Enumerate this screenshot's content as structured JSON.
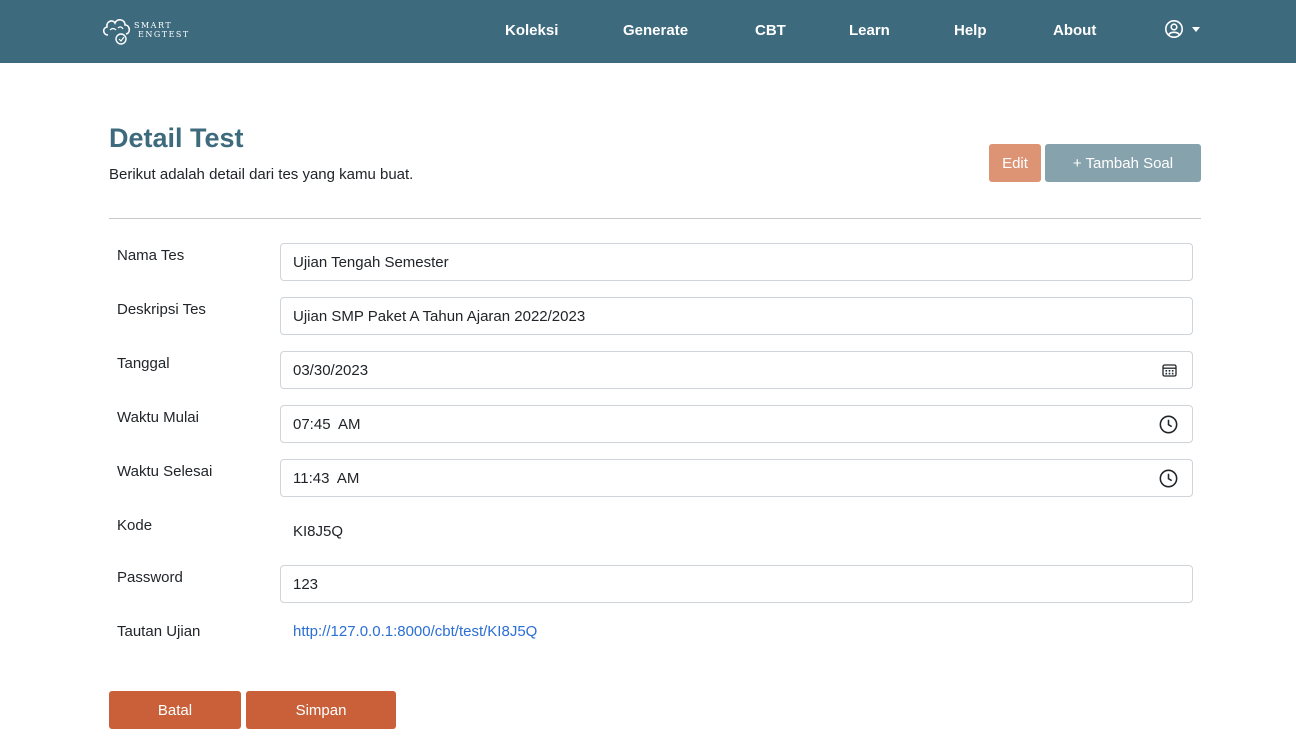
{
  "navbar": {
    "brand_line1": "SMART",
    "brand_line2": "ENGTEST",
    "links": [
      "Koleksi",
      "Generate",
      "CBT",
      "Learn",
      "Help",
      "About"
    ],
    "user_icon": "user-circle-icon",
    "background": "#3e6a7e"
  },
  "header": {
    "title": "Detail Test",
    "subtitle": "Berikut adalah detail dari tes yang kamu buat.",
    "edit_label": "Edit",
    "add_question_label": "+ Tambah Soal"
  },
  "form": {
    "name_label": "Nama Tes",
    "name_value": "Ujian Tengah Semester",
    "description_label": "Deskripsi Tes",
    "description_value": "Ujian SMP Paket A Tahun Ajaran 2022/2023",
    "date_label": "Tanggal",
    "date_value": "03/30/2023",
    "start_label": "Waktu Mulai",
    "start_value": "07:45  AM",
    "end_label": "Waktu Selesai",
    "end_value": "11:43  AM",
    "code_label": "Kode",
    "code_value": "KI8J5Q",
    "password_label": "Password",
    "password_value": "123",
    "link_label": "Tautan Ujian",
    "link_value": "http://127.0.0.1:8000/cbt/test/KI8J5Q"
  },
  "actions": {
    "cancel_label": "Batal",
    "save_label": "Simpan"
  },
  "colors": {
    "accent": "#3e6a7e",
    "edit_button": "#dc9475",
    "add_button": "#86a2ad",
    "primary_action": "#c9603a",
    "link": "#2b6ed4"
  }
}
